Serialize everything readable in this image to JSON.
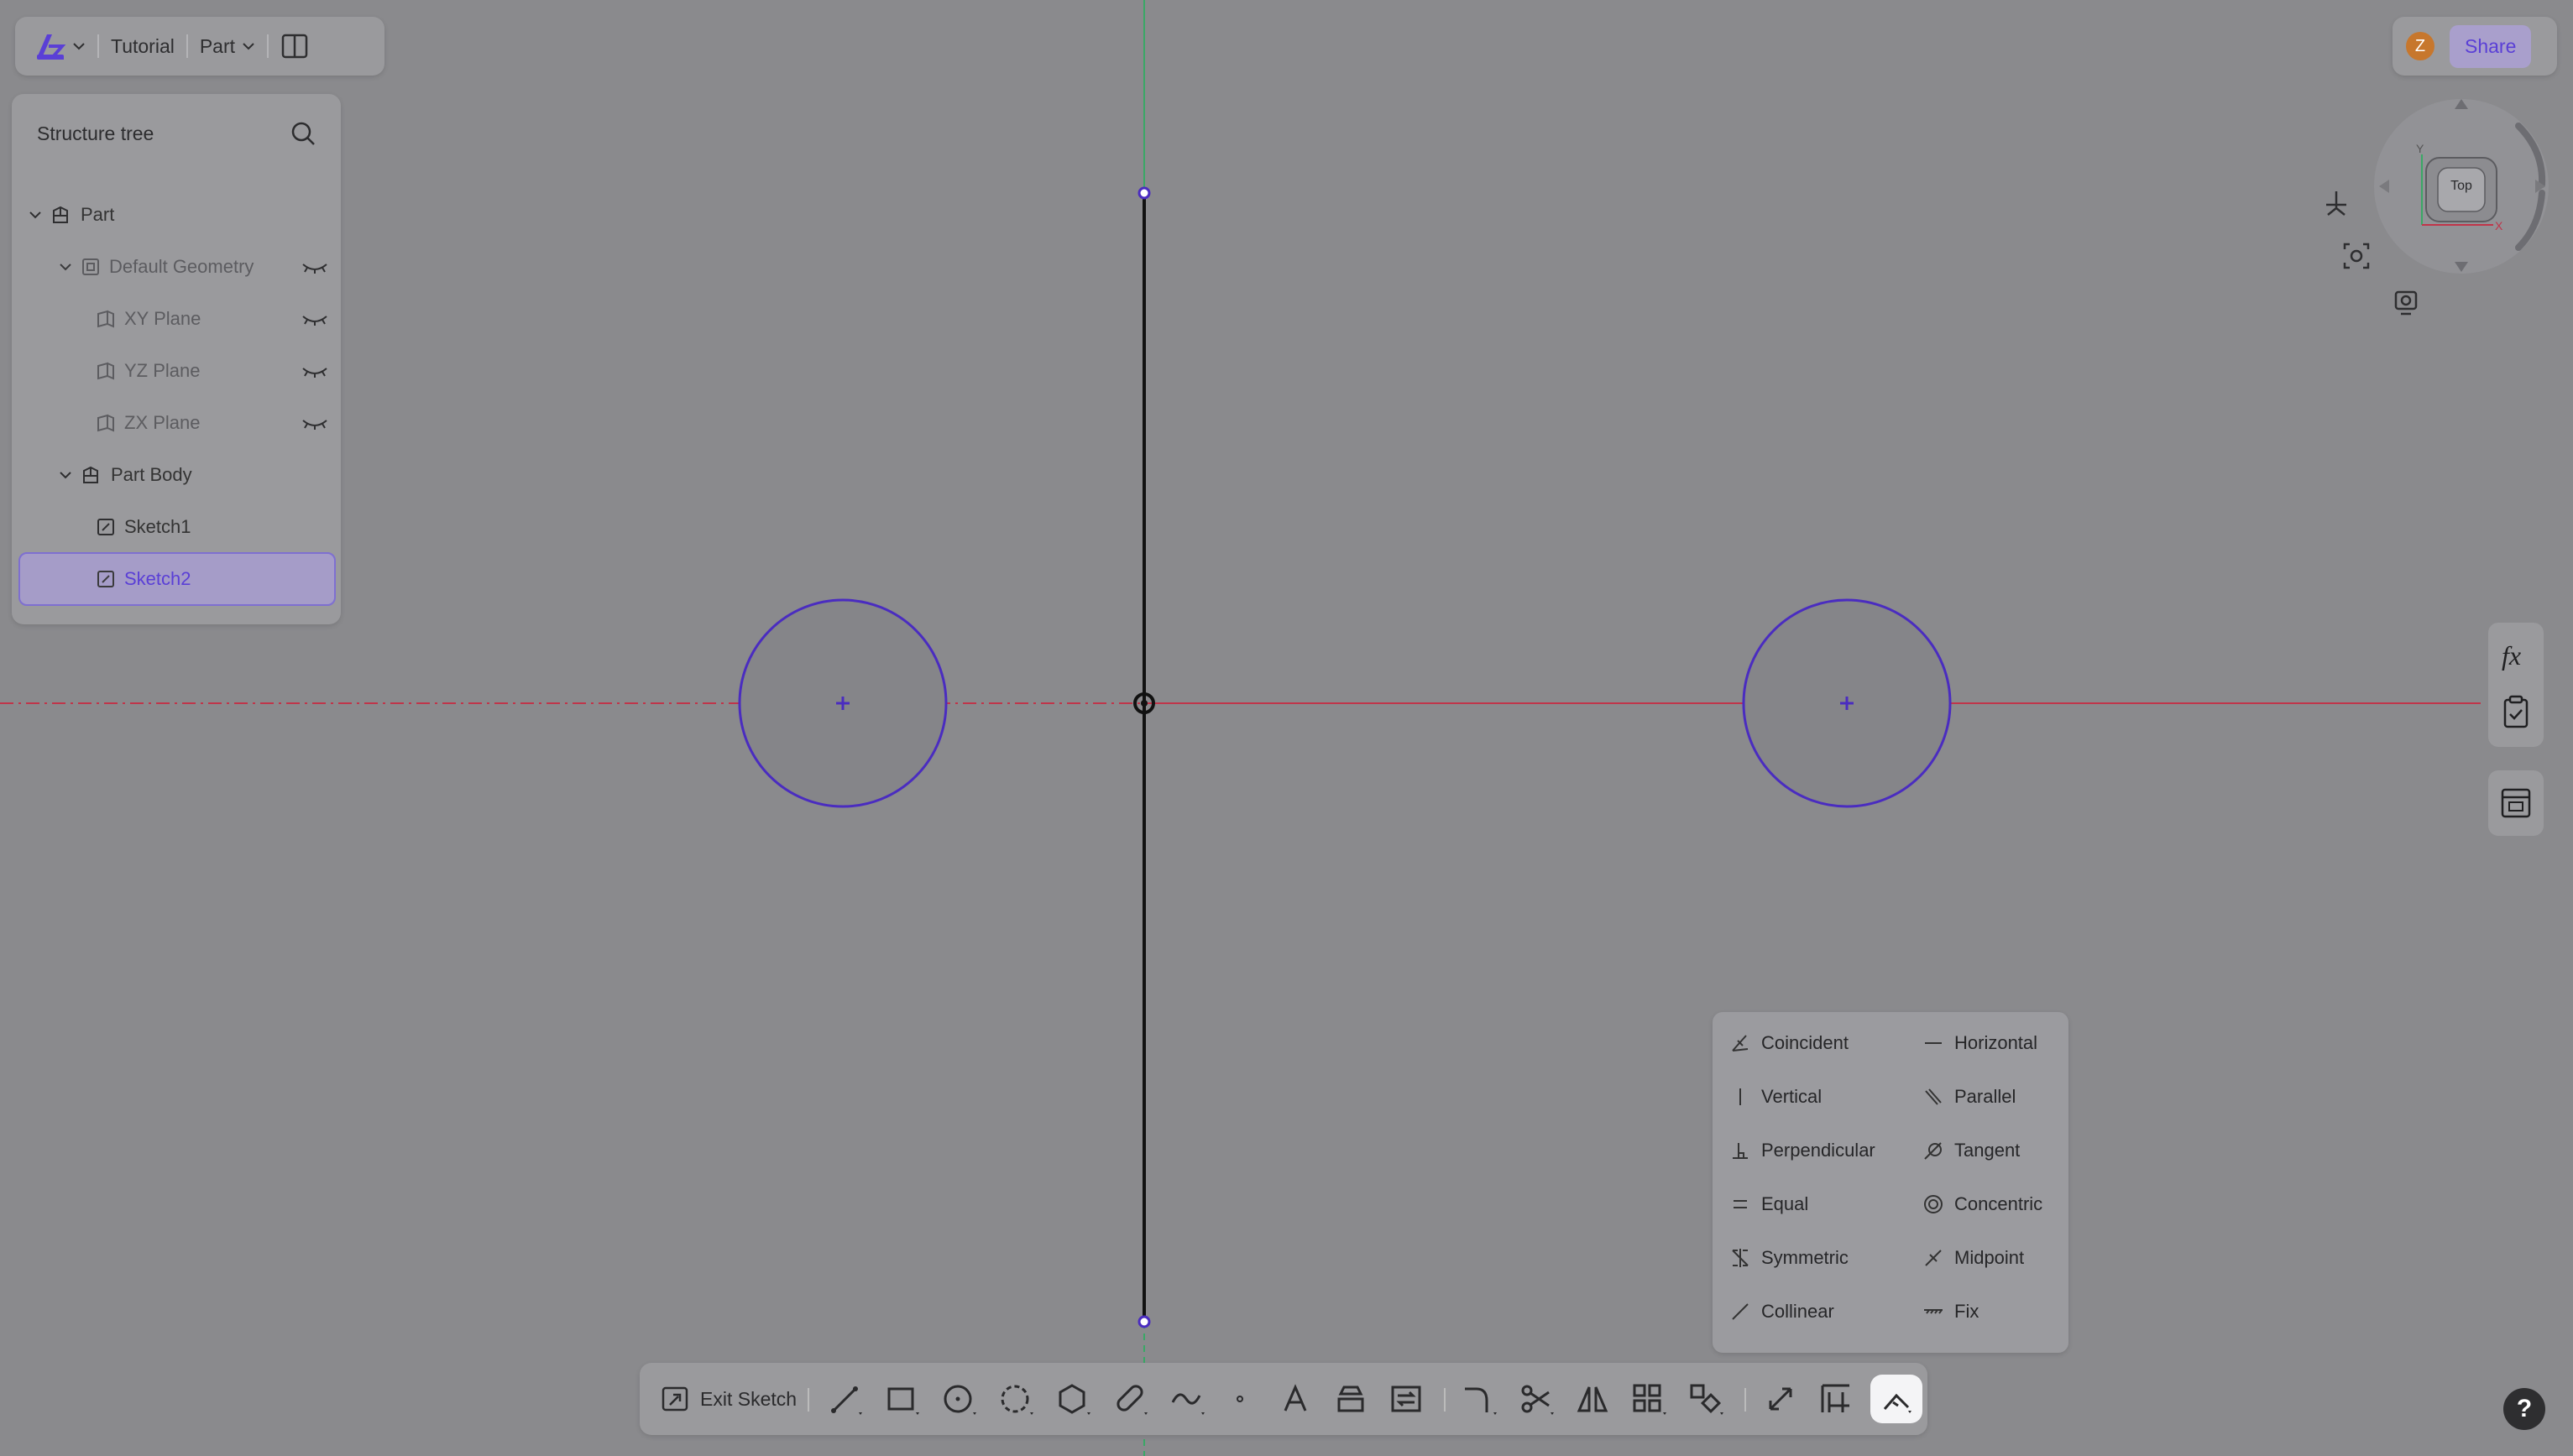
{
  "topbar": {
    "doc_name": "Tutorial",
    "mode": "Part"
  },
  "tree": {
    "title": "Structure tree",
    "items": [
      {
        "label": "Part"
      },
      {
        "label": "Default Geometry"
      },
      {
        "label": "XY Plane"
      },
      {
        "label": "YZ Plane"
      },
      {
        "label": "ZX Plane"
      },
      {
        "label": "Part Body"
      },
      {
        "label": "Sketch1"
      },
      {
        "label": "Sketch2"
      }
    ]
  },
  "share": {
    "avatar_letter": "Z",
    "button_label": "Share"
  },
  "viewcube": {
    "face_label": "Top",
    "axis_x": "X",
    "axis_y": "Y"
  },
  "constraints": {
    "left": [
      "Coincident",
      "Vertical",
      "Perpendicular",
      "Equal",
      "Symmetric",
      "Collinear"
    ],
    "right": [
      "Horizontal",
      "Parallel",
      "Tangent",
      "Concentric",
      "Midpoint",
      "Fix"
    ]
  },
  "toolbar": {
    "exit_label": "Exit Sketch"
  },
  "help": {
    "label": "?"
  },
  "colors": {
    "accent": "#5a3fd6",
    "x_axis": "#c0354a",
    "y_axis": "#3aa866",
    "circle_stroke": "#4a2cc0"
  }
}
